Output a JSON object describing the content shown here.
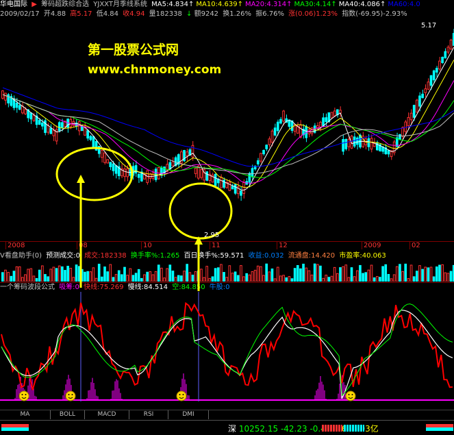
{
  "header": {
    "stock_name": "华电国际",
    "arrow": "▶",
    "indicator_name": "筹码超跌综合选",
    "system_name": "YJXXT月季线系统",
    "ma": [
      {
        "label": "MA5:4.834",
        "color": "#ffffff",
        "arrow": "↑"
      },
      {
        "label": "MA10:4.639",
        "color": "#ffff00",
        "arrow": "↑"
      },
      {
        "label": "MA20:4.314",
        "color": "#ff00ff",
        "arrow": "↑"
      },
      {
        "label": "MA30:4.14",
        "color": "#00ff00",
        "arrow": "↑"
      },
      {
        "label": "MA40:4.086",
        "color": "#ffffff",
        "arrow": "↑"
      },
      {
        "label": "MA60:4.0",
        "color": "#0000ff",
        "arrow": ""
      }
    ]
  },
  "info": {
    "date": "2009/02/17",
    "open": "开4.88",
    "high": "高5.17",
    "low": "低4.84",
    "close": "收4.94",
    "volume": "量182338",
    "amount": "额9242",
    "turnover": "换1.26%",
    "amplitude": "振6.76%",
    "change": "涨(0.06)1.23%",
    "index": "指数(-69.95)-2.93%"
  },
  "price_high_label": "5.17",
  "price_low_label": "2.95",
  "watermark": {
    "title": "第一股票公式网",
    "url": "www.chnmoney.com"
  },
  "time_axis": [
    "2008",
    "08",
    "10",
    "11",
    "12",
    "2009",
    "02"
  ],
  "volume_panel": {
    "name": "V看盘助手(0)",
    "forecast": "预测成交:0",
    "deal": "成交:182338",
    "turnover_rate": "换手率%:1.265",
    "hundred_day": "百日换手%:59.571",
    "net_assets": "收益:0.032",
    "float": "流通盘:14.420",
    "pe": "市盈率:40.063"
  },
  "indicator_panel": {
    "name": "一个筹码波段公式",
    "buy": "吸筹:0",
    "fast": "快线:75.269",
    "slow": "慢线:84.514",
    "short": "空:84.850",
    "bull": "牛股:0"
  },
  "tabs": [
    "MA",
    "BOLL",
    "MACD",
    "RSI",
    "DMI"
  ],
  "status": {
    "market": "深",
    "value": "10252.15",
    "change": "-42.23",
    "percent": "-0.41%",
    "amount": "664.03亿"
  },
  "colors": {
    "up": "#ff3232",
    "down": "#00ffff",
    "ma5": "#ffffff",
    "ma10": "#ffff00",
    "ma20": "#ff00ff",
    "ma30": "#00ff00",
    "ma60": "#0000ff",
    "circle": "#ffff00"
  }
}
